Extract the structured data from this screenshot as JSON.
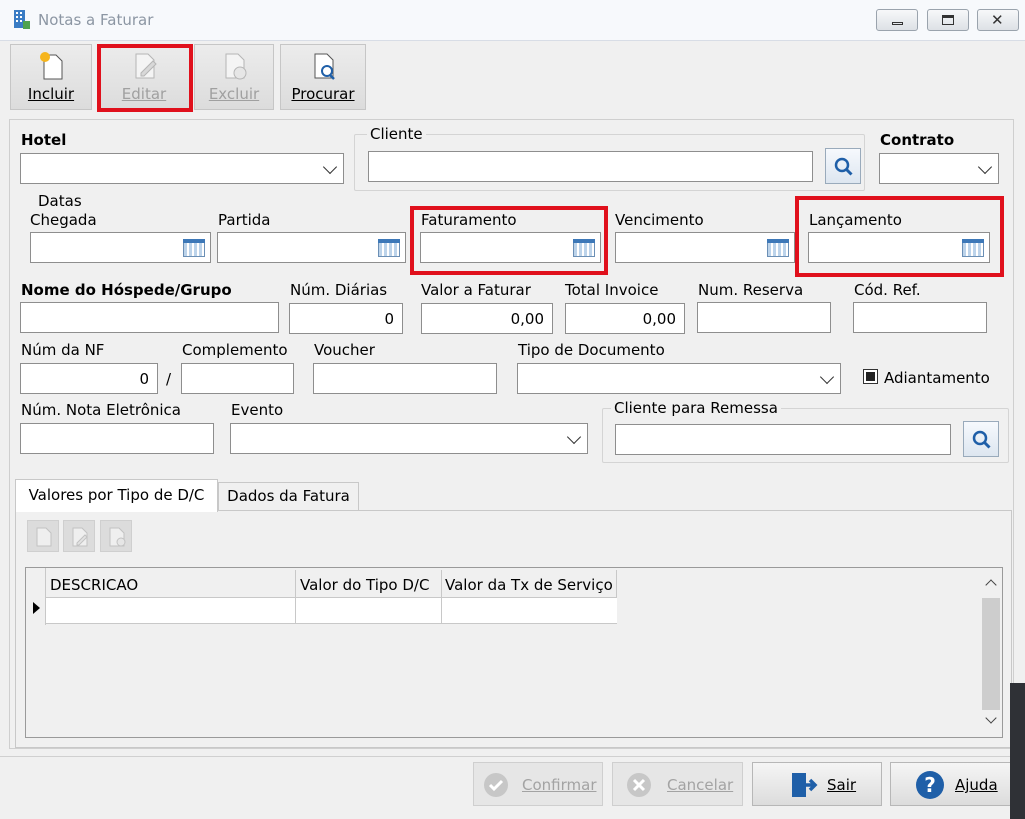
{
  "window": {
    "title": "Notas a Faturar"
  },
  "toolbar": {
    "incluir": "Incluir",
    "editar": "Editar",
    "excluir": "Excluir",
    "procurar": "Procurar"
  },
  "form": {
    "hotel": {
      "label": "Hotel",
      "value": ""
    },
    "cliente": {
      "label": "Cliente",
      "value": ""
    },
    "contrato": {
      "label": "Contrato",
      "value": ""
    },
    "datas": {
      "label": "Datas"
    },
    "chegada": {
      "label": "Chegada",
      "value": ""
    },
    "partida": {
      "label": "Partida",
      "value": ""
    },
    "faturamento": {
      "label": "Faturamento",
      "value": ""
    },
    "vencimento": {
      "label": "Vencimento",
      "value": ""
    },
    "lancamento": {
      "label": "Lançamento",
      "value": ""
    },
    "nome_hospede": {
      "label": "Nome do Hóspede/Grupo",
      "value": ""
    },
    "num_diarias": {
      "label": "Núm. Diárias",
      "value": "0"
    },
    "valor_faturar": {
      "label": "Valor a Faturar",
      "value": "0,00"
    },
    "total_invoice": {
      "label": "Total Invoice",
      "value": "0,00"
    },
    "num_reserva": {
      "label": "Num. Reserva",
      "value": ""
    },
    "cod_ref": {
      "label": "Cód. Ref.",
      "value": ""
    },
    "num_nf": {
      "label": "Núm da NF",
      "value": "0"
    },
    "separator": "/",
    "complemento": {
      "label": "Complemento",
      "value": ""
    },
    "voucher": {
      "label": "Voucher",
      "value": ""
    },
    "tipo_documento": {
      "label": "Tipo de Documento",
      "value": ""
    },
    "adiantamento": {
      "label": "Adiantamento",
      "checked": true
    },
    "num_nota_eletronica": {
      "label": "Núm. Nota Eletrônica",
      "value": ""
    },
    "evento": {
      "label": "Evento",
      "value": ""
    },
    "cliente_remessa": {
      "label": "Cliente para Remessa",
      "value": ""
    }
  },
  "tabs": [
    {
      "label": "Valores por Tipo de D/C",
      "active": true
    },
    {
      "label": "Dados da Fatura",
      "active": false
    }
  ],
  "grid": {
    "columns": [
      "DESCRICAO",
      "Valor do Tipo D/C",
      "Valor da Tx de Serviço"
    ],
    "rows": [
      [
        "",
        "",
        ""
      ]
    ]
  },
  "footer": {
    "confirmar": "Confirmar",
    "cancelar": "Cancelar",
    "sair": "Sair",
    "ajuda": "Ajuda"
  },
  "colors": {
    "highlight": "#e0101c",
    "accent": "#1f5fa8"
  }
}
